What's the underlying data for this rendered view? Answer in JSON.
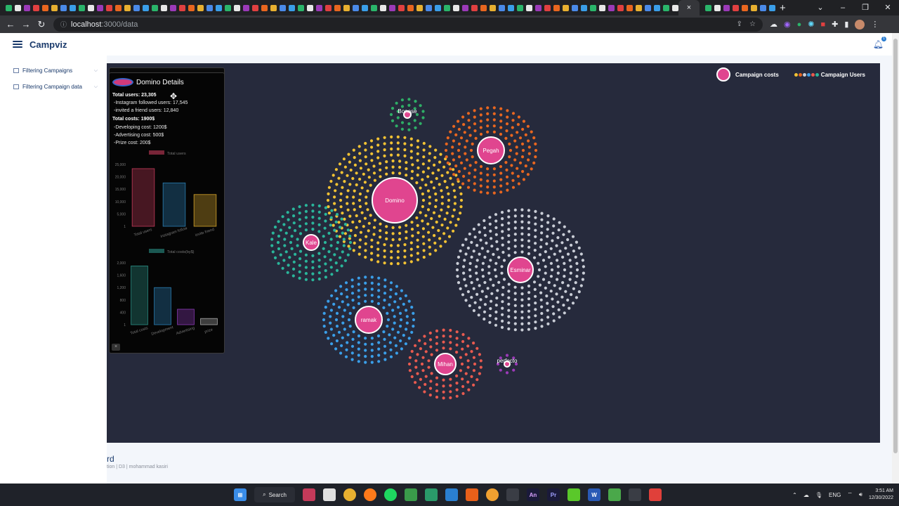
{
  "browser": {
    "url_host": "localhost",
    "url_path": ":3000/data",
    "active_tab_close": "×",
    "new_tab": "+"
  },
  "app": {
    "title": "Campviz",
    "notification_count": "1"
  },
  "sidebar": {
    "items": [
      {
        "label": "Filtering Campaigns"
      },
      {
        "label": "Filtering Campaign data"
      }
    ]
  },
  "legend": {
    "costs_label": "Campaign costs",
    "users_label": "Campaign Users"
  },
  "campaigns": [
    {
      "name": "Domino",
      "color": "#f2c233"
    },
    {
      "name": "Pegah",
      "color": "#e8661f"
    },
    {
      "name": "Esminar",
      "color": "#c9cdd6"
    },
    {
      "name": "ramak",
      "color": "#3a9ee8"
    },
    {
      "name": "Mihan",
      "color": "#e85a4f"
    },
    {
      "name": "Kale",
      "color": "#2ab59a"
    },
    {
      "name": "Bonose",
      "color": "#2eae66"
    },
    {
      "name": "perfecto",
      "color": "#9b3ab8"
    }
  ],
  "details": {
    "title": "Domino Details",
    "total_users": "Total users: 23,305",
    "instagram": "-Instagram followed users: 17,545",
    "invited": "-invited a friend users: 12,840",
    "total_costs": "Total costs: 1900$",
    "developing": "-Developing cost: 1200$",
    "advertising": "-Advertising cost: 500$",
    "prize": "-Prize cost: 200$",
    "close": "×"
  },
  "chart_data": [
    {
      "type": "bar",
      "title": "Total users",
      "categories": [
        "Total users",
        "instagram follow",
        "invite friend"
      ],
      "values": [
        23305,
        17545,
        12840
      ],
      "colors": [
        "#c43a5a",
        "#2a7fb5",
        "#d6a52a"
      ],
      "yticks": [
        "25,000",
        "20,000",
        "15,000",
        "10,000",
        "5,000",
        "1"
      ],
      "ylim": [
        0,
        25000
      ]
    },
    {
      "type": "bar",
      "title": "Total costs(by$)",
      "categories": [
        "Total costs",
        "Development",
        "Advertising",
        "prize"
      ],
      "values": [
        1900,
        1200,
        500,
        200
      ],
      "colors": [
        "#2a8f85",
        "#2a7fb5",
        "#8a3ab5",
        "#aaaaaa"
      ],
      "yticks": [
        "2,000",
        "1,600",
        "1,200",
        "800",
        "400",
        "1"
      ],
      "ylim": [
        0,
        2000
      ]
    }
  ],
  "footer": {
    "title": "rd",
    "subtitle": "tion | D3 | mohammad kasiri"
  },
  "taskbar": {
    "search_label": "Search",
    "lang": "ENG",
    "time": "3:51 AM",
    "date": "12/30/2022"
  }
}
